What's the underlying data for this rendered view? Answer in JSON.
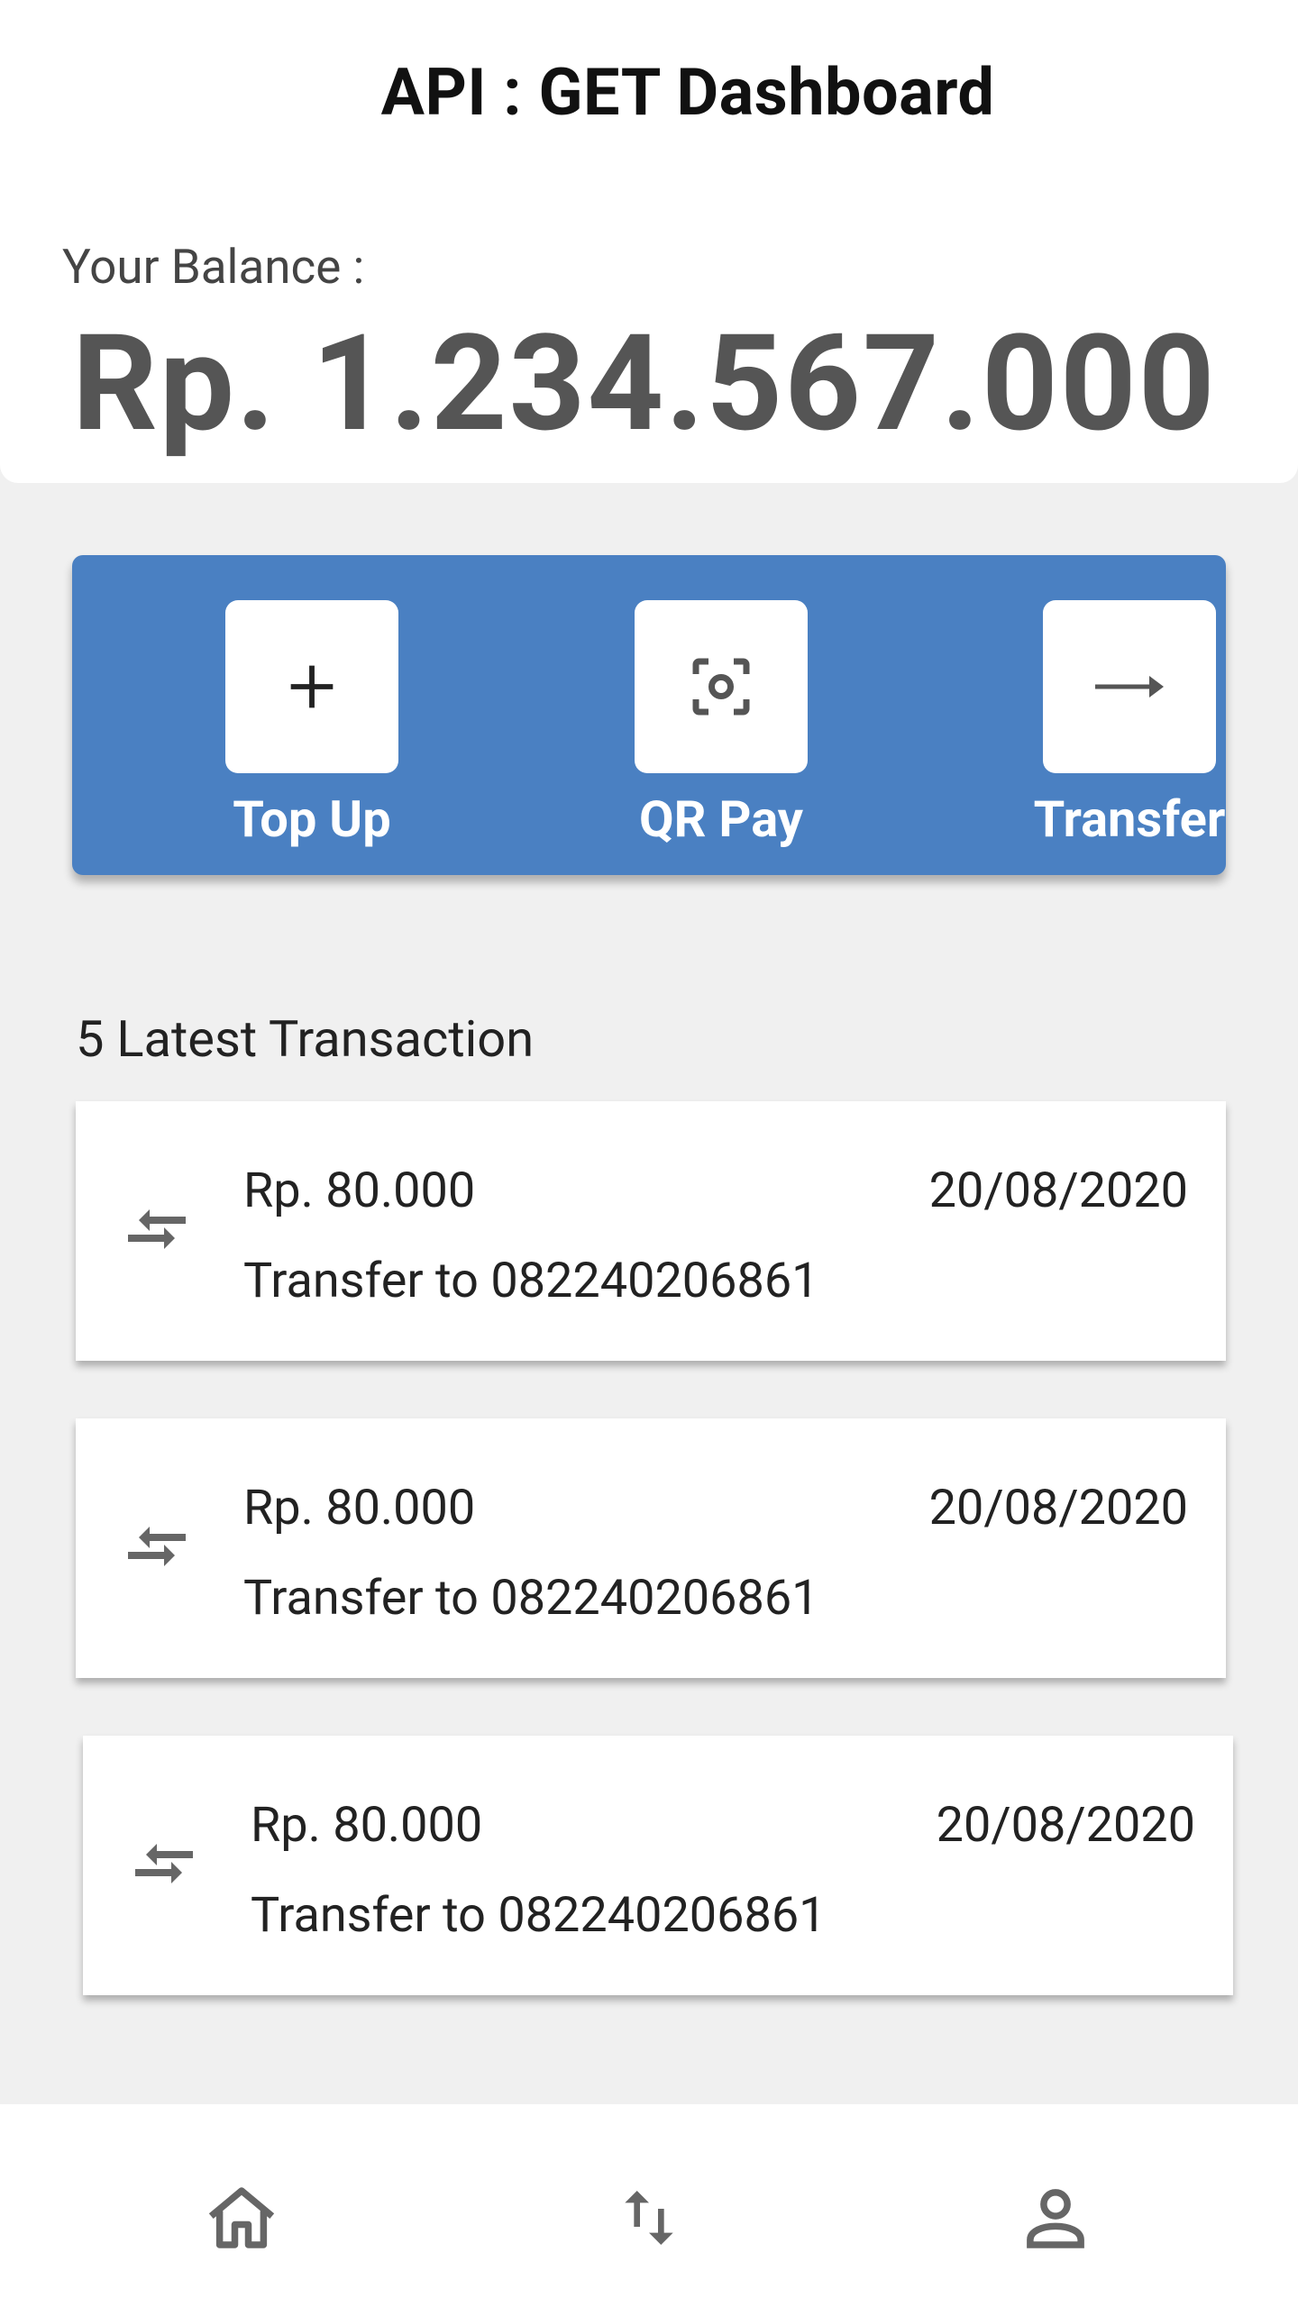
{
  "header": {
    "title": "API : GET Dashboard"
  },
  "balance": {
    "label": "Your Balance :",
    "value": "Rp. 1.234.567.000"
  },
  "actions": [
    {
      "label": "Top Up",
      "icon": "plus-icon"
    },
    {
      "label": "QR Pay",
      "icon": "qr-scan-icon"
    },
    {
      "label": "Transfer",
      "icon": "arrow-right-icon"
    }
  ],
  "transactions_section": {
    "title": "5 Latest Transaction"
  },
  "transactions": [
    {
      "amount": "Rp. 80.000",
      "description": "Transfer to 082240206861",
      "date": "20/08/2020",
      "icon": "transfer-arrows-icon"
    },
    {
      "amount": "Rp. 80.000",
      "description": "Transfer to 082240206861",
      "date": "20/08/2020",
      "icon": "transfer-arrows-icon"
    },
    {
      "amount": "Rp. 80.000",
      "description": "Transfer to 082240206861",
      "date": "20/08/2020",
      "icon": "transfer-arrows-icon"
    }
  ],
  "bottom_nav": [
    {
      "icon": "home-icon"
    },
    {
      "icon": "swap-vertical-icon"
    },
    {
      "icon": "profile-icon"
    }
  ],
  "colors": {
    "accent": "#4a80c2",
    "background": "#f0f0f0",
    "surface": "#ffffff",
    "icon_gray": "#666666"
  }
}
